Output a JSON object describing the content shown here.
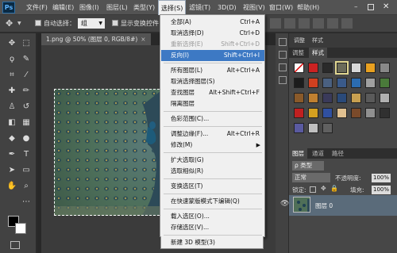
{
  "app": {
    "logo": "Ps"
  },
  "menubar": {
    "items": [
      "文件(F)",
      "编辑(E)",
      "图像(I)",
      "图层(L)",
      "类型(Y)",
      "选择(S)",
      "滤镜(T)",
      "3D(D)",
      "视图(V)",
      "窗口(W)",
      "帮助(H)"
    ],
    "active": "选择(S)"
  },
  "options": {
    "auto_select_label": "自动选择：",
    "auto_select_value": "组",
    "transform_label": "显示变换控件"
  },
  "document": {
    "tab_title": "1.png @ 50% (图层 0, RGB/8#)",
    "tab_close": "×"
  },
  "select_menu": {
    "items": [
      {
        "label": "全部(A)",
        "shortcut": "Ctrl+A",
        "disabled": false
      },
      {
        "label": "取消选择(D)",
        "shortcut": "Ctrl+D",
        "disabled": false
      },
      {
        "label": "重新选择(E)",
        "shortcut": "Shift+Ctrl+D",
        "disabled": true
      },
      {
        "label": "反向(I)",
        "shortcut": "Shift+Ctrl+I",
        "highlighted": true
      },
      {
        "label": "所有图层(L)",
        "shortcut": "Alt+Ctrl+A"
      },
      {
        "label": "取消选择图层(S)",
        "shortcut": ""
      },
      {
        "label": "查找图层",
        "shortcut": "Alt+Shift+Ctrl+F"
      },
      {
        "label": "隔离图层",
        "shortcut": ""
      },
      {
        "label": "色彩范围(C)...",
        "shortcut": ""
      },
      {
        "label": "调整边缘(F)...",
        "shortcut": "Alt+Ctrl+R"
      },
      {
        "label": "修改(M)",
        "shortcut": "",
        "submenu": true
      },
      {
        "label": "扩大选取(G)",
        "shortcut": ""
      },
      {
        "label": "选取相似(R)",
        "shortcut": ""
      },
      {
        "label": "变换选区(T)",
        "shortcut": ""
      },
      {
        "label": "在快速蒙版模式下编辑(Q)",
        "shortcut": ""
      },
      {
        "label": "载入选区(O)...",
        "shortcut": ""
      },
      {
        "label": "存储选区(V)...",
        "shortcut": ""
      },
      {
        "label": "新建 3D 模型(3)",
        "shortcut": ""
      }
    ]
  },
  "panels": {
    "top_mini": [
      "调整",
      "样式"
    ],
    "swatch_tabs": [
      "调整",
      "样式"
    ],
    "layer_tabs": [
      "图层",
      "通道",
      "路径"
    ],
    "kind_filter": "ρ 类型",
    "blend_mode": "正常",
    "opacity_label": "不透明度:",
    "opacity_value": "100%",
    "lock_label": "锁定:",
    "fill_label": "填充:",
    "fill_value": "100%",
    "layer_name": "图层 0"
  },
  "colors": {
    "menu_highlight": "#3d79c4",
    "foreground": "#000000",
    "background": "#ffffff"
  }
}
